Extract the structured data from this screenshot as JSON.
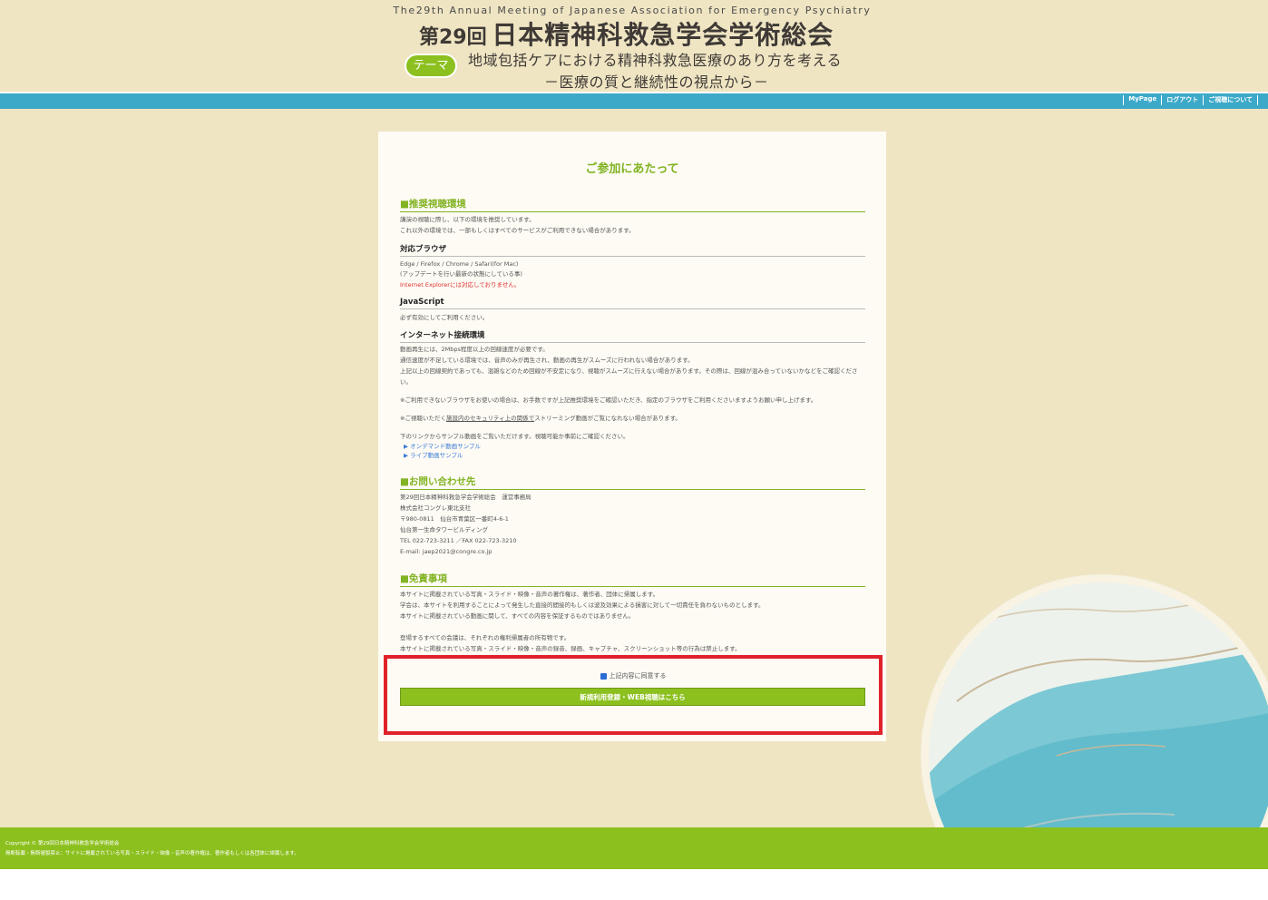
{
  "header": {
    "subtitle_en": "The29th Annual Meeting of Japanese Association for Emergency Psychiatry",
    "title_prefix": "第29回",
    "title_main": "日本精神科救急学会学術総会",
    "theme_badge": "テーマ",
    "theme_line1": "地域包括ケアにおける精神科救急医療のあり方を考える",
    "theme_line2": "－医療の質と継続性の視点から－"
  },
  "nav": {
    "mypage": "MyPage",
    "logout": "ログアウト",
    "about": "ご視聴について"
  },
  "card": {
    "title": "ご参加にあたって",
    "env": {
      "heading": "■推奨視聴環境",
      "intro1": "講演の視聴に際し、以下の環境を推奨しています。",
      "intro2": "これ以外の環境では、一部もしくはすべてのサービスがご利用できない場合があります。",
      "browser_head": "対応ブラウザ",
      "browser_list": "Edge / Firefox / Chrome / Safari(for Mac)",
      "browser_note": "(アップデートを行い最新の状態にしている事)",
      "ie_warning": "Internet Explorerには対応しておりません。",
      "js_head": "JavaScript",
      "js_text": "必ず有効にしてご利用ください。",
      "net_head": "インターネット接続環境",
      "net1": "動画再生には、2Mbps程度以上の回線速度が必要です。",
      "net2": "通信速度が不足している環境では、音声のみが再生され、動画の再生がスムーズに行われない場合があります。",
      "net3": "上記以上の回線契約であっても、混雑などのため回線が不安定になり、視聴がスムーズに行えない場合があります。その際は、回線が混み合っていないかなどをご確認ください。",
      "note1": "※ご利用できないブラウザをお使いの場合は、お手数ですが上記推奨環境をご確認いただき、指定のブラウザをご利用くださいますようお願い申し上げます。",
      "note2_a": "※ご視聴いただく",
      "note2_b": "施設内のセキュリティ上の関係で",
      "note2_c": "ストリーミング動画がご覧になれない場合があります。",
      "sample_intro": "下のリンクからサンプル動画をご覧いただけます。視聴可能か事前にご確認ください。",
      "sample_ondemand": "▶ オンデマンド動画サンプル",
      "sample_live": "▶ ライブ動画サンプル"
    },
    "contact": {
      "heading": "■お問い合わせ先",
      "l1": "第29回日本精神科救急学会学術総会　運営事務局",
      "l2": "株式会社コングレ東北支社",
      "l3": "〒980-0811　仙台市青葉区一番町4-6-1",
      "l4": "仙台第一生命タワービルディング",
      "l5": "TEL 022-723-3211 ／FAX 022-723-3210",
      "l6": "E-mail: jaep2021@congre.co.jp"
    },
    "disclaimer": {
      "heading": "■免責事項",
      "l1": "本サイトに掲載されている写真・スライド・映像・音声の著作権は、著作者、団体に帰属します。",
      "l2": "学会は、本サイトを利用することによって発生した直接的間接的もしくは波及効果による損害に対して一切責任を負わないものとします。",
      "l3": "本サイトに掲載されている動画に関して、すべての内容を保証するものではありません。",
      "l4": "登場するすべての会議は、それぞれの権利帰属者の所有物です。",
      "l5": "本サイトに掲載されている写真・スライド・映像・音声の録音、録画、キャプチャ、スクリーンショット等の行為は禁止します。"
    }
  },
  "agree": {
    "checkbox_label": "上記内容に同意する",
    "checked": true,
    "register_button": "新規利用登録・WEB視聴はこちら"
  },
  "footer": {
    "copyright": "Copyright © 第29回日本精神科救急学会学術総会",
    "notice": "無断転載・無断複製禁止：サイトに掲載されている写真・スライド・映像・音声の著作権は、著作者もしくは各団体に帰属します。"
  },
  "colors": {
    "accent_green": "#8cc01f",
    "nav_blue": "#3ca9c9",
    "background": "#efe5c3",
    "highlight_red": "#e0222a"
  }
}
